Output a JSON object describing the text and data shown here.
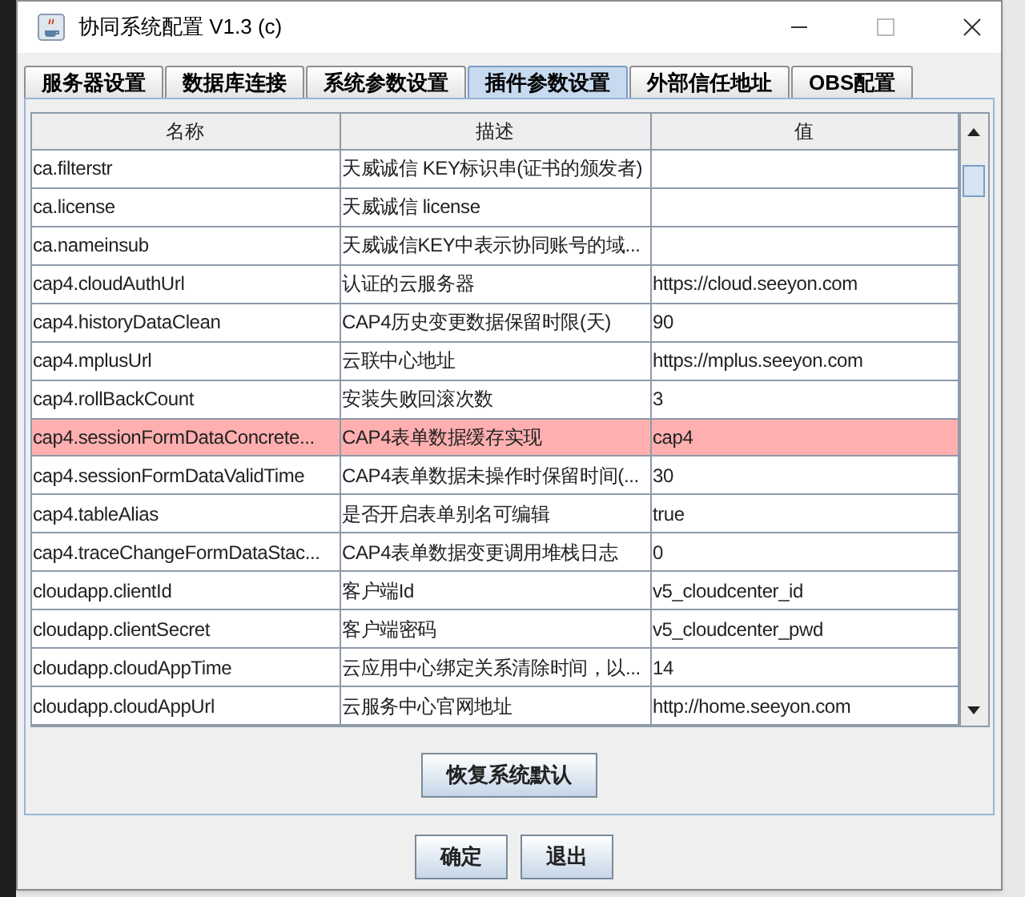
{
  "window": {
    "title": "协同系统配置 V1.3 (c)"
  },
  "tabs": [
    {
      "label": "服务器设置",
      "selected": false
    },
    {
      "label": "数据库连接",
      "selected": false
    },
    {
      "label": "系统参数设置",
      "selected": false
    },
    {
      "label": "插件参数设置",
      "selected": true
    },
    {
      "label": "外部信任地址",
      "selected": false
    },
    {
      "label": "OBS配置",
      "selected": false
    }
  ],
  "table": {
    "columns": [
      "名称",
      "描述",
      "值"
    ],
    "rows": [
      {
        "cells": [
          "ca.filterstr",
          "天威诚信 KEY标识串(证书的颁发者)",
          ""
        ],
        "selected": false
      },
      {
        "cells": [
          "ca.license",
          "天威诚信 license",
          ""
        ],
        "selected": false
      },
      {
        "cells": [
          "ca.nameinsub",
          "天威诚信KEY中表示协同账号的域...",
          ""
        ],
        "selected": false
      },
      {
        "cells": [
          "cap4.cloudAuthUrl",
          "认证的云服务器",
          "https://cloud.seeyon.com"
        ],
        "selected": false
      },
      {
        "cells": [
          "cap4.historyDataClean",
          "CAP4历史变更数据保留时限(天)",
          "90"
        ],
        "selected": false
      },
      {
        "cells": [
          "cap4.mplusUrl",
          "云联中心地址",
          "https://mplus.seeyon.com"
        ],
        "selected": false
      },
      {
        "cells": [
          "cap4.rollBackCount",
          "安装失败回滚次数",
          "3"
        ],
        "selected": false
      },
      {
        "cells": [
          "cap4.sessionFormDataConcrete...",
          "CAP4表单数据缓存实现",
          "cap4"
        ],
        "selected": true
      },
      {
        "cells": [
          "cap4.sessionFormDataValidTime",
          "CAP4表单数据未操作时保留时间(...",
          "30"
        ],
        "selected": false
      },
      {
        "cells": [
          "cap4.tableAlias",
          "是否开启表单别名可编辑",
          "true"
        ],
        "selected": false
      },
      {
        "cells": [
          "cap4.traceChangeFormDataStac...",
          "CAP4表单数据变更调用堆栈日志",
          "0"
        ],
        "selected": false
      },
      {
        "cells": [
          "cloudapp.clientId",
          "客户端Id",
          "v5_cloudcenter_id"
        ],
        "selected": false
      },
      {
        "cells": [
          "cloudapp.clientSecret",
          "客户端密码",
          "v5_cloudcenter_pwd"
        ],
        "selected": false
      },
      {
        "cells": [
          "cloudapp.cloudAppTime",
          "云应用中心绑定关系清除时间，以...",
          "14"
        ],
        "selected": false
      },
      {
        "cells": [
          "cloudapp.cloudAppUrl",
          "云服务中心官网地址",
          "http://home.seeyon.com"
        ],
        "selected": false
      }
    ]
  },
  "restore_button": "恢复系统默认",
  "buttons": [
    "确定",
    "退出"
  ]
}
